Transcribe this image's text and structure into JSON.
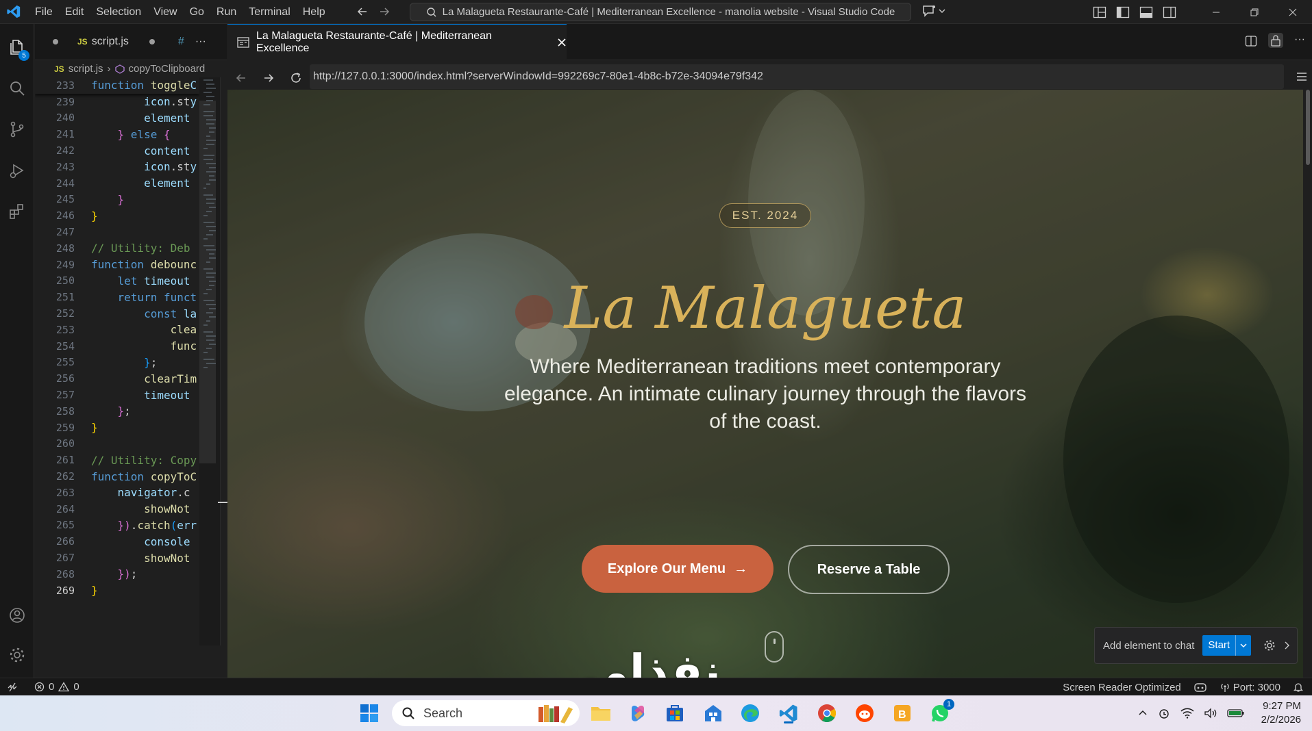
{
  "titlebar": {
    "menu": [
      "File",
      "Edit",
      "Selection",
      "View",
      "Go",
      "Run",
      "Terminal",
      "Help"
    ],
    "command_center": "La Malagueta Restaurante-Café | Mediterranean Excellence - manolia website - Visual Studio Code"
  },
  "activity": {
    "explorer_badge": "5"
  },
  "editor": {
    "tab_label": "script.js",
    "tab2_label": "#",
    "breadcrumb_file": "script.js",
    "breadcrumb_symbol": "copyToClipboard",
    "lines": [
      {
        "n": "233",
        "sticky": true
      },
      {
        "n": "239"
      },
      {
        "n": "240"
      },
      {
        "n": "241"
      },
      {
        "n": "242"
      },
      {
        "n": "243"
      },
      {
        "n": "244"
      },
      {
        "n": "245"
      },
      {
        "n": "246"
      },
      {
        "n": "247"
      },
      {
        "n": "248"
      },
      {
        "n": "249"
      },
      {
        "n": "250"
      },
      {
        "n": "251"
      },
      {
        "n": "252"
      },
      {
        "n": "253"
      },
      {
        "n": "254"
      },
      {
        "n": "255"
      },
      {
        "n": "256"
      },
      {
        "n": "257"
      },
      {
        "n": "258"
      },
      {
        "n": "259"
      },
      {
        "n": "260"
      },
      {
        "n": "261"
      },
      {
        "n": "262"
      },
      {
        "n": "263"
      },
      {
        "n": "264"
      },
      {
        "n": "265"
      },
      {
        "n": "266"
      },
      {
        "n": "267"
      },
      {
        "n": "268"
      },
      {
        "n": "269",
        "current": true
      }
    ],
    "code": [
      [
        [
          "kw",
          "function "
        ],
        [
          "fn",
          "toggle"
        ],
        [
          "vr",
          "C"
        ]
      ],
      [
        [
          "",
          "        "
        ],
        [
          "vr",
          "icon"
        ],
        [
          "",
          ".st"
        ],
        [
          "vr",
          "y"
        ]
      ],
      [
        [
          "",
          "        "
        ],
        [
          "vr",
          "element"
        ]
      ],
      [
        [
          "",
          "    "
        ],
        [
          "br2",
          "} "
        ],
        [
          "kw",
          "else "
        ],
        [
          "br2",
          "{"
        ]
      ],
      [
        [
          "",
          "        "
        ],
        [
          "vr",
          "content"
        ]
      ],
      [
        [
          "",
          "        "
        ],
        [
          "vr",
          "icon"
        ],
        [
          "",
          ".st"
        ],
        [
          "vr",
          "y"
        ]
      ],
      [
        [
          "",
          "        "
        ],
        [
          "vr",
          "element"
        ]
      ],
      [
        [
          "",
          "    "
        ],
        [
          "br2",
          "}"
        ]
      ],
      [
        [
          "br",
          "}"
        ]
      ],
      [
        [
          "",
          ""
        ]
      ],
      [
        [
          "cm",
          "// Utility: Deb"
        ]
      ],
      [
        [
          "kw",
          "function "
        ],
        [
          "fn",
          "debounc"
        ]
      ],
      [
        [
          "",
          "    "
        ],
        [
          "kw",
          "let "
        ],
        [
          "vr",
          "timeout"
        ]
      ],
      [
        [
          "",
          "    "
        ],
        [
          "kw",
          "return "
        ],
        [
          "kw",
          "funct"
        ]
      ],
      [
        [
          "",
          "        "
        ],
        [
          "kw",
          "const "
        ],
        [
          "vr",
          "la"
        ]
      ],
      [
        [
          "",
          "            "
        ],
        [
          "fn",
          "clea"
        ]
      ],
      [
        [
          "",
          "            "
        ],
        [
          "fn",
          "func"
        ]
      ],
      [
        [
          "",
          "        "
        ],
        [
          "br3",
          "}"
        ],
        [
          "",
          ";"
        ]
      ],
      [
        [
          "",
          "        "
        ],
        [
          "fn",
          "clearTim"
        ]
      ],
      [
        [
          "",
          "        "
        ],
        [
          "vr",
          "timeout"
        ]
      ],
      [
        [
          "",
          "    "
        ],
        [
          "br2",
          "}"
        ],
        [
          "",
          ";"
        ]
      ],
      [
        [
          "br",
          "}"
        ]
      ],
      [
        [
          "",
          ""
        ]
      ],
      [
        [
          "cm",
          "// Utility: Copy"
        ]
      ],
      [
        [
          "kw",
          "function "
        ],
        [
          "fn",
          "copyToC"
        ]
      ],
      [
        [
          "",
          "    "
        ],
        [
          "vr",
          "navigator"
        ],
        [
          "",
          ".c"
        ]
      ],
      [
        [
          "",
          "        "
        ],
        [
          "fn",
          "showNot"
        ]
      ],
      [
        [
          "",
          "    "
        ],
        [
          "br2",
          "})"
        ],
        [
          "",
          "."
        ],
        [
          "fn",
          "catch"
        ],
        [
          "br3",
          "("
        ],
        [
          "vr",
          "err"
        ]
      ],
      [
        [
          "",
          "        "
        ],
        [
          "vr",
          "console"
        ]
      ],
      [
        [
          "",
          "        "
        ],
        [
          "fn",
          "showNot"
        ]
      ],
      [
        [
          "",
          "    "
        ],
        [
          "br2",
          "})"
        ],
        [
          "",
          ";"
        ]
      ],
      [
        [
          "br",
          "}"
        ]
      ]
    ]
  },
  "browser": {
    "tab_title": "La Malagueta Restaurante-Café | Mediterranean Excellence",
    "url": "http://127.0.0.1:3000/index.html?serverWindowId=992269c7-80e1-4b8c-b72e-34094e79f342"
  },
  "hero": {
    "badge": "EST. 2024",
    "title": "La Malagueta",
    "subtitle": "Where Mediterranean traditions meet contemporary elegance. An intimate culinary journey through the flavors of the coast.",
    "primary_button": "Explore Our Menu",
    "primary_arrow": "→",
    "secondary_button": "Reserve a Table"
  },
  "chat_widget": {
    "label": "Add element to chat",
    "start": "Start"
  },
  "watermark": "نفذلی",
  "statusbar": {
    "errors": "0",
    "warnings": "0",
    "screen_reader": "Screen Reader Optimized",
    "port": "Port: 3000"
  },
  "taskbar": {
    "search_placeholder": "Search",
    "whatsapp_badge": "1",
    "time": "9:27 PM",
    "date": "2/2/2026"
  },
  "colors": {
    "accent": "#0078d4",
    "hero_gold": "#d9b25a",
    "cta_orange": "#c9623f"
  }
}
